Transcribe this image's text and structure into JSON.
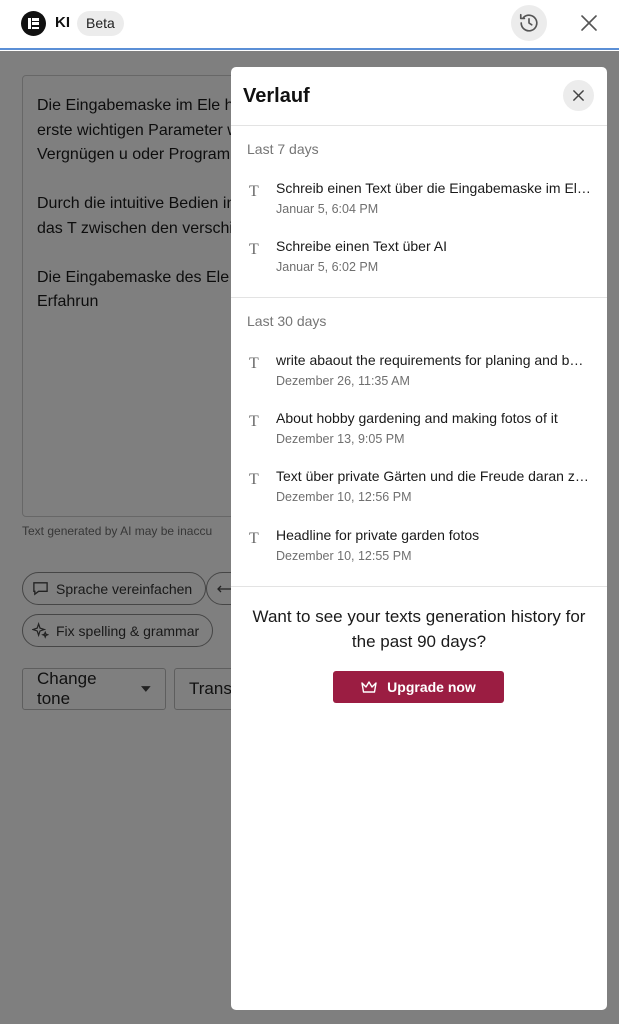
{
  "header": {
    "app_title": "KI",
    "badge": "Beta",
    "icons": {
      "logo": "elementor-logo",
      "history": "history-icon",
      "close": "close-icon"
    }
  },
  "editor": {
    "paragraphs": [
      "Die Eingabemaske im Ele hilft, schnell und einfach s für deine Website zu erste wichtigen Parameter wie P ohne selbst Code schreibe Website zum Vergnügen u oder Programmiersprache",
      "Durch die intuitive Bedien individuelle Bedürfnisse e entwickeln. Dabei ist das T zwischen den verschieden dich dabei überfordert od",
      "Die Eingabemaske des Ele für jede Person, die eine W keine oder wenig Erfahrun"
    ],
    "disclaimer": "Text generated by AI may be inaccu",
    "chips": [
      {
        "label": "Sprache vereinfachen",
        "icon": "speech-bubble-icon"
      },
      {
        "label": "",
        "icon": "arrows-left-right-icon"
      },
      {
        "label": "Fix spelling & grammar",
        "icon": "sparkle-icon"
      }
    ],
    "selects": [
      {
        "label": "Change tone",
        "icon": "caret-down-icon"
      },
      {
        "label": "Trans"
      }
    ]
  },
  "history_panel": {
    "title": "Verlauf",
    "sections": [
      {
        "label": "Last 7 days",
        "items": [
          {
            "title": "Schreib einen Text über die Eingabemaske im Elementor",
            "date": "Januar 5, 6:04 PM"
          },
          {
            "title": "Schreibe einen Text über AI",
            "date": "Januar 5, 6:02 PM"
          }
        ]
      },
      {
        "label": "Last 30 days",
        "items": [
          {
            "title": "write abaout the requirements for planing and building",
            "date": "Dezember 26, 11:35 AM"
          },
          {
            "title": "About hobby gardening and making fotos of it",
            "date": "Dezember 13, 9:05 PM"
          },
          {
            "title": "Text über private Gärten und die Freude daran zu haben",
            "date": "Dezember 10, 12:56 PM"
          },
          {
            "title": "Headline for private garden fotos",
            "date": "Dezember 10, 12:55 PM"
          }
        ]
      }
    ],
    "upsell_text": "Want to see your texts generation history for the past 90 days?",
    "upgrade_label": "Upgrade now",
    "item_icon": "text-T-icon",
    "upgrade_icon": "crown-icon"
  },
  "colors": {
    "accent_border": "#5b8fd6",
    "upgrade_button": "#9b1d42",
    "overlay": "rgba(0,0,0,0.5)"
  }
}
